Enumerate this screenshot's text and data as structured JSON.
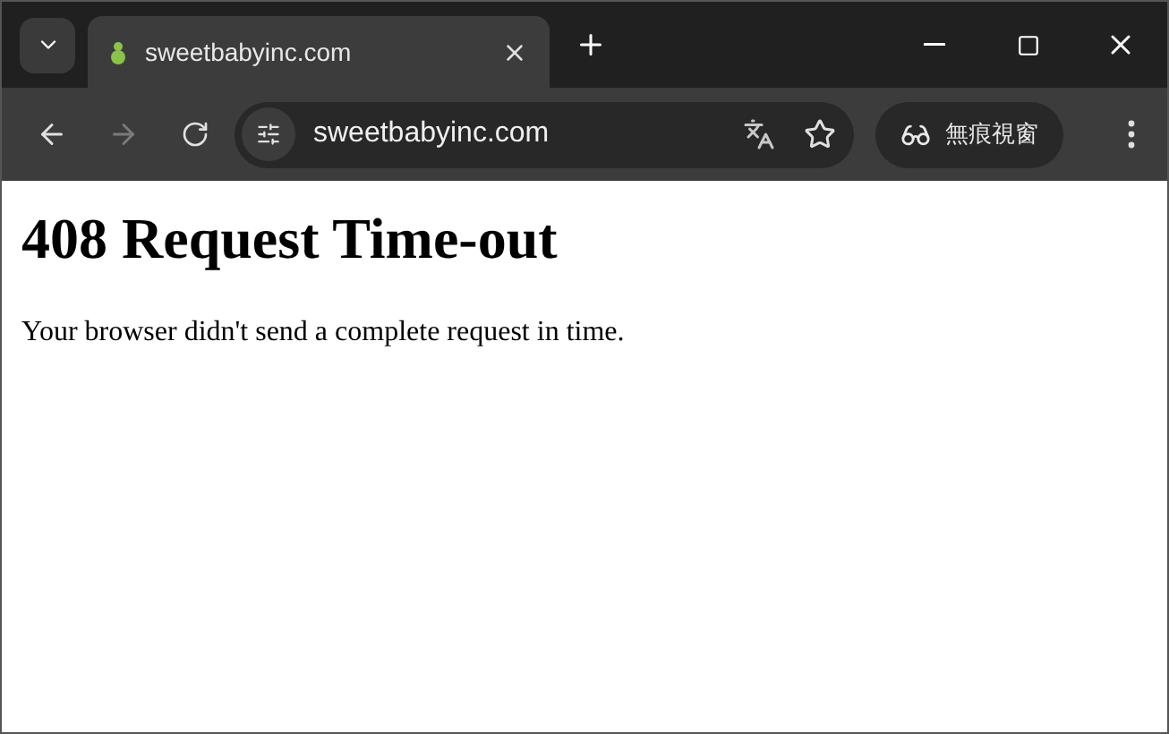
{
  "tab": {
    "title": "sweetbabyinc.com",
    "selected": true
  },
  "address_bar": {
    "value": "sweetbabyinc.com"
  },
  "incognito": {
    "label": "無痕視窗"
  },
  "page": {
    "heading": "408 Request Time-out",
    "message": "Your browser didn't send a complete request in time."
  }
}
